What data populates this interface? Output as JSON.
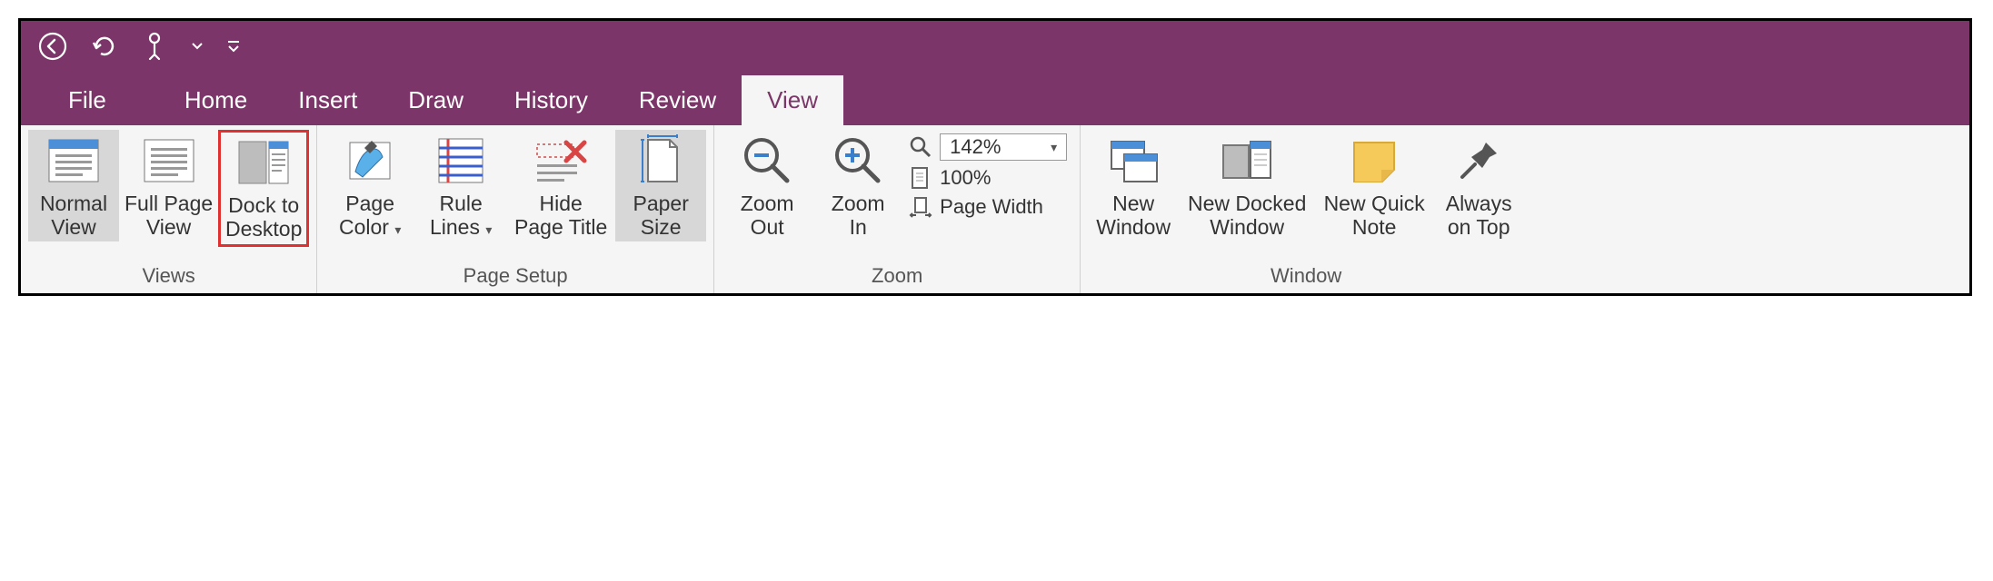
{
  "colors": {
    "brand": "#7c3568",
    "ribbon_bg": "#f5f5f5",
    "highlight": "#e03030"
  },
  "tabs": {
    "file": "File",
    "home": "Home",
    "insert": "Insert",
    "draw": "Draw",
    "history": "History",
    "review": "Review",
    "view": "View"
  },
  "groups": {
    "views": {
      "label": "Views",
      "normal_view": "Normal\nView",
      "full_page_view": "Full Page\nView",
      "dock_to_desktop": "Dock to\nDesktop"
    },
    "page_setup": {
      "label": "Page Setup",
      "page_color": "Page\nColor",
      "rule_lines": "Rule\nLines",
      "hide_page_title": "Hide\nPage Title",
      "paper_size": "Paper\nSize"
    },
    "zoom": {
      "label": "Zoom",
      "zoom_out": "Zoom\nOut",
      "zoom_in": "Zoom\nIn",
      "level": "142%",
      "hundred": "100%",
      "page_width": "Page Width"
    },
    "window": {
      "label": "Window",
      "new_window": "New\nWindow",
      "new_docked_window": "New Docked\nWindow",
      "new_quick_note": "New Quick\nNote",
      "always_on_top": "Always\non Top"
    }
  }
}
